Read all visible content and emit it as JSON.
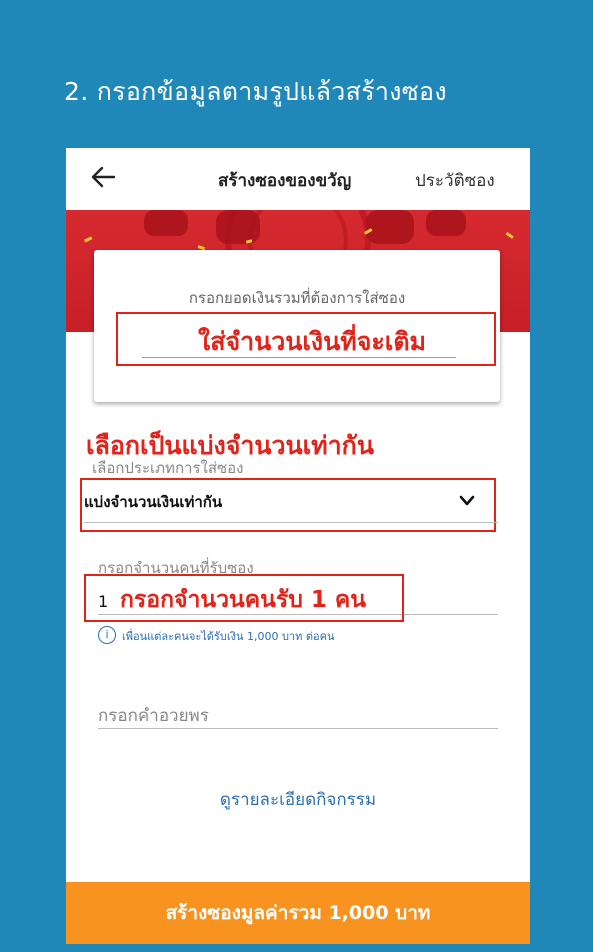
{
  "step_title": "2. กรอกข้อมูลตามรูปแล้วสร้างซอง",
  "topbar": {
    "title": "สร้างซองของขวัญ",
    "history": "ประวัติซอง"
  },
  "amount_card": {
    "label": "กรอกยอดเงินรวมที่ต้องการใส่ซอง",
    "annotation": "ใส่จำนวนเงินที่จะเติม"
  },
  "type_annotation": "เลือกเป็นแบ่งจำนวนเท่ากัน",
  "type_field": {
    "label": "เลือกประเภทการใส่ซอง",
    "value": "แบ่งจำนวนเงินเท่ากัน"
  },
  "count_field": {
    "label": "กรอกจำนวนคนที่รับซอง",
    "value": "1",
    "annotation": "กรอกจำนวนคนรับ 1 คน"
  },
  "info": "เพื่อนแต่ละคนจะได้รับเงิน 1,000 บาท ต่อคน",
  "blessing_placeholder": "กรอกคำอวยพร",
  "details_link": "ดูรายละเอียดกิจกรรม",
  "cta": "สร้างซองมูลค่ารวม 1,000 บาท",
  "colors": {
    "background": "#2088b9",
    "banner": "#d52a2f",
    "annotation": "#e2231a",
    "link": "#2a6fb5",
    "cta": "#f7931e"
  }
}
